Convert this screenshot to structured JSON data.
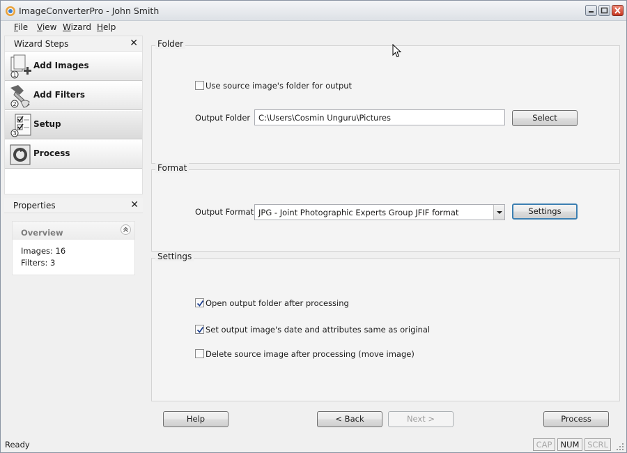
{
  "window": {
    "title": "ImageConverterPro - John Smith"
  },
  "menu": {
    "items": [
      {
        "label": "File",
        "hot": "F",
        "rest": "ile"
      },
      {
        "label": "View",
        "hot": "V",
        "rest": "iew"
      },
      {
        "label": "Wizard",
        "hot": "W",
        "rest": "izard"
      },
      {
        "label": "Help",
        "hot": "H",
        "rest": "elp"
      }
    ]
  },
  "wizard_steps": {
    "title": "Wizard Steps",
    "close": "✕",
    "steps": [
      {
        "label": "Add Images",
        "icon": "add-images-icon",
        "number": "1"
      },
      {
        "label": "Add Filters",
        "icon": "add-filters-icon",
        "number": "2"
      },
      {
        "label": "Setup",
        "icon": "setup-icon",
        "number": "3"
      },
      {
        "label": "Process",
        "icon": "process-icon"
      }
    ]
  },
  "properties": {
    "title": "Properties",
    "close": "✕",
    "overview": {
      "title": "Overview",
      "images": "Images: 16",
      "filters": "Filters: 3"
    }
  },
  "folder": {
    "label": "Folder",
    "use_source_label": "Use source image's folder for output",
    "use_source_checked": false,
    "output_folder_label": "Output Folder",
    "output_folder_value": "C:\\Users\\Cosmin Unguru\\Pictures",
    "select_label": "Select"
  },
  "format": {
    "label": "Format",
    "output_format_label": "Output Format",
    "output_format_value": "JPG - Joint Photographic Experts Group JFIF format",
    "settings_label": "Settings"
  },
  "settings": {
    "label": "Settings",
    "options": [
      {
        "label": "Open output folder after processing",
        "checked": true
      },
      {
        "label": "Set output image's date and attributes same as original",
        "checked": true
      },
      {
        "label": "Delete source image after processing (move image)",
        "checked": false
      }
    ]
  },
  "buttons": {
    "help": "Help",
    "back": "< Back",
    "next": "Next >",
    "process": "Process"
  },
  "status": {
    "text": "Ready",
    "cap": "CAP",
    "num": "NUM",
    "scrl": "SCRL"
  }
}
